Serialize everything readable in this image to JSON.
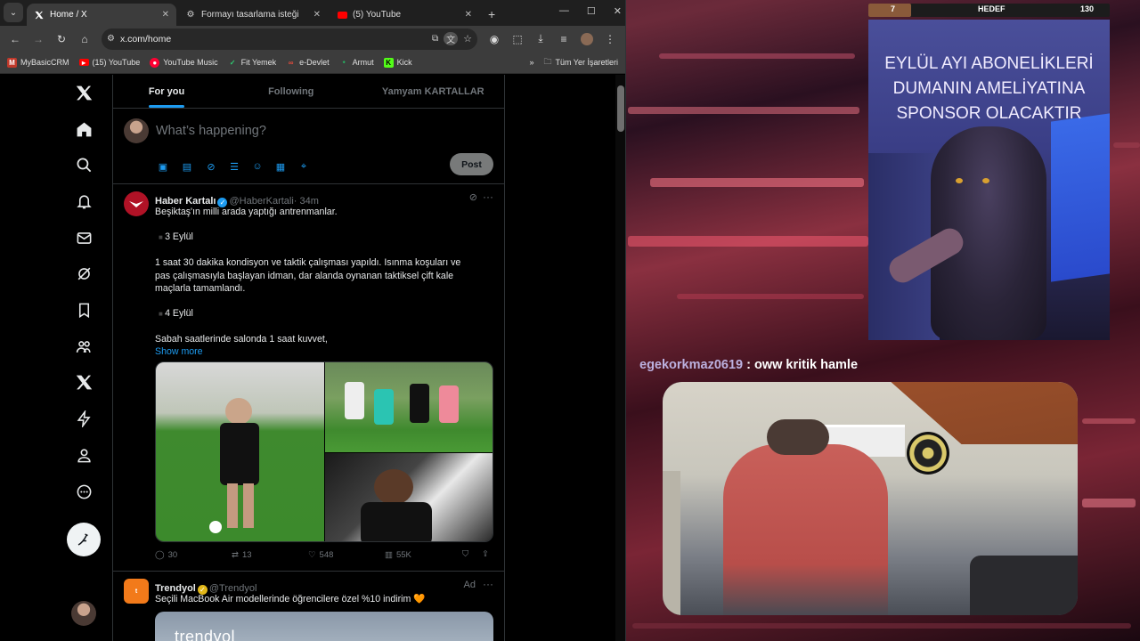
{
  "browser": {
    "tabs": [
      {
        "title": "Home / X",
        "icon": "x-logo-icon",
        "active": true
      },
      {
        "title": "Formayı tasarlama isteği",
        "icon": "chatgpt-icon",
        "active": false
      },
      {
        "title": "(5) YouTube",
        "icon": "youtube-icon",
        "active": false
      }
    ],
    "new_tab": "+",
    "url": "x.com/home",
    "bookmarks": [
      {
        "label": "MyBasicCRM",
        "icon": "crm-icon",
        "color": "#c0392b"
      },
      {
        "label": "(15) YouTube",
        "icon": "youtube-icon",
        "color": "#ff0000"
      },
      {
        "label": "YouTube Music",
        "icon": "youtube-music-icon",
        "color": "#ff0033"
      },
      {
        "label": "Fit Yemek",
        "icon": "fit-yemek-icon",
        "color": "#2ecc71"
      },
      {
        "label": "e-Devlet",
        "icon": "e-devlet-icon",
        "color": "#e74c3c"
      },
      {
        "label": "Armut",
        "icon": "armut-icon",
        "color": "#27ae60"
      },
      {
        "label": "Kick",
        "icon": "kick-icon",
        "color": "#53fc18"
      }
    ],
    "all_bookmarks": "Tüm Yer İşaretleri"
  },
  "x": {
    "tabs": [
      "For you",
      "Following",
      "Yamyam KARTALLAR"
    ],
    "compose_placeholder": "What’s happening?",
    "post_button": "Post",
    "tweets": [
      {
        "name": "Haber Kartalı",
        "handle": "@HaberKartali",
        "time": "· 34m",
        "lines": [
          "Beşiktaş'ın milli arada yaptığı antrenmanlar.",
          "3 Eylül",
          "1 saat 30 dakika kondisyon ve taktik çalışması yapıldı. Isınma koşuları ve",
          "pas çalışmasıyla başlayan idman, dar alanda oynanan taktiksel çift kale",
          "maçlarla tamamlandı.",
          "4 Eylül",
          "Sabah saatlerinde salonda 1 saat kuvvet,"
        ],
        "show_more": "Show more",
        "stats": {
          "replies": "30",
          "reposts": "13",
          "likes": "548",
          "views": "55K"
        }
      },
      {
        "name": "Trendyol",
        "handle": "@Trendyol",
        "ad": "Ad",
        "text": "Seçili MacBook Air modellerinde öğrencilere özel %10 indirim 🧡",
        "media_text": "trendyol"
      }
    ]
  },
  "stream": {
    "goal": {
      "current": "7",
      "label": "HEDEF",
      "target": "130",
      "progress": 0.054
    },
    "announcement": [
      "EYLÜL AYI ABONELİKLERİ",
      "DUMANIN AMELİYATINA",
      "SPONSOR OLACAKTIR"
    ],
    "chat": {
      "user": "egekorkmaz0619",
      "separator": " : ",
      "message": "oww kritik hamle"
    }
  },
  "colors": {
    "accent": "#1d9bf0",
    "background": "#000000"
  }
}
